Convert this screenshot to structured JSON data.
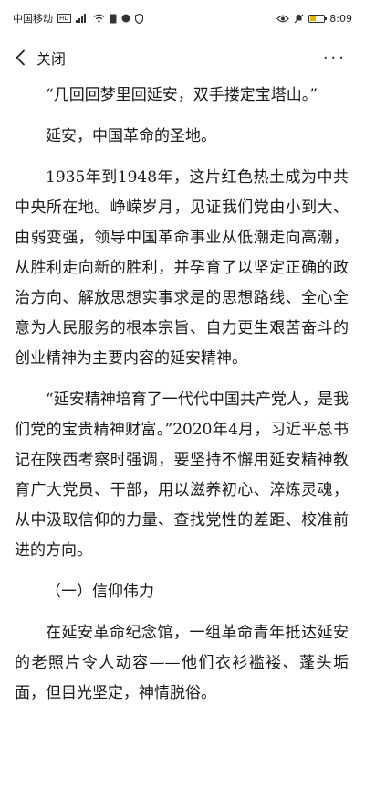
{
  "status_bar": {
    "carrier": "中国移动",
    "network": "HD",
    "time": "8:09",
    "battery_level": 0.4,
    "battery_color": "#e8b400"
  },
  "nav": {
    "back_icon": "chevron-left-icon",
    "title": "关闭",
    "more_icon": "more-horizontal-icon",
    "more_label": "···"
  },
  "article": {
    "paragraphs": [
      "“几回回梦里回延安，双手搂定宝塔山。”",
      "延安，中国革命的圣地。",
      "1935年到1948年，这片红色热土成为中共中央所在地。峥嵘岁月，见证我们党由小到大、由弱变强，领导中国革命事业从低潮走向高潮，从胜利走向新的胜利，并孕育了以坚定正确的政治方向、解放思想实事求是的思想路线、全心全意为人民服务的根本宗旨、自力更生艰苦奋斗的创业精神为主要内容的延安精神。",
      "“延安精神培育了一代代中国共产党人，是我们党的宝贵精神财富。”2020年4月，习近平总书记在陕西考察时强调，要坚持不懈用延安精神教育广大党员、干部，用以滋养初心、淬炼灵魂，从中汲取信仰的力量、查找党性的差距、校准前进的方向。",
      "（一）信仰伟力",
      "在延安革命纪念馆，一组革命青年抵达延安的老照片令人动容——他们衣衫褴褛、蓬头垢面，但目光坚定，神情脱俗。"
    ]
  }
}
